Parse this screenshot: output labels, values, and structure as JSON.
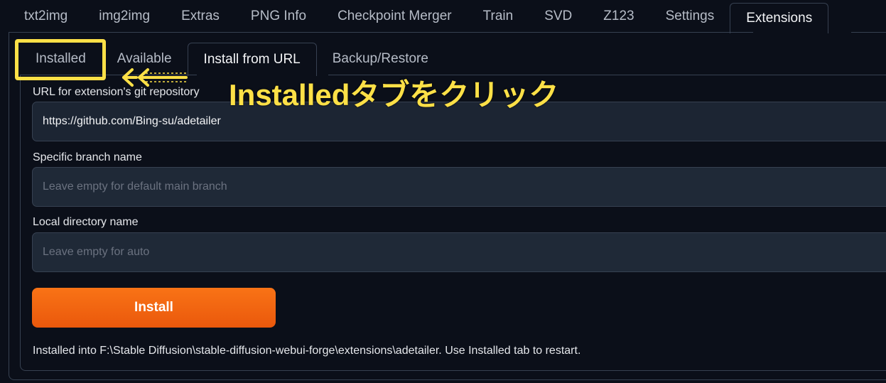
{
  "top_tabs": [
    {
      "label": "txt2img"
    },
    {
      "label": "img2img"
    },
    {
      "label": "Extras"
    },
    {
      "label": "PNG Info"
    },
    {
      "label": "Checkpoint Merger"
    },
    {
      "label": "Train"
    },
    {
      "label": "SVD"
    },
    {
      "label": "Z123"
    },
    {
      "label": "Settings"
    },
    {
      "label": "Extensions"
    }
  ],
  "active_top_tab": "Extensions",
  "sub_tabs": [
    {
      "label": "Installed"
    },
    {
      "label": "Available"
    },
    {
      "label": "Install from URL"
    },
    {
      "label": "Backup/Restore"
    }
  ],
  "active_sub_tab": "Install from URL",
  "form": {
    "url_label": "URL for extension's git repository",
    "url_value": "https://github.com/Bing-su/adetailer",
    "branch_label": "Specific branch name",
    "branch_placeholder": "Leave empty for default main branch",
    "dir_label": "Local directory name",
    "dir_placeholder": "Leave empty for auto",
    "install_label": "Install"
  },
  "status": "Installed into F:\\Stable Diffusion\\stable-diffusion-webui-forge\\extensions\\adetailer. Use Installed tab to restart.",
  "annotation": {
    "text": "Installedタブをクリック",
    "color": "#fde047"
  },
  "colors": {
    "background": "#0b0f19",
    "input_bg": "#1f2937",
    "accent": "#f97316"
  }
}
